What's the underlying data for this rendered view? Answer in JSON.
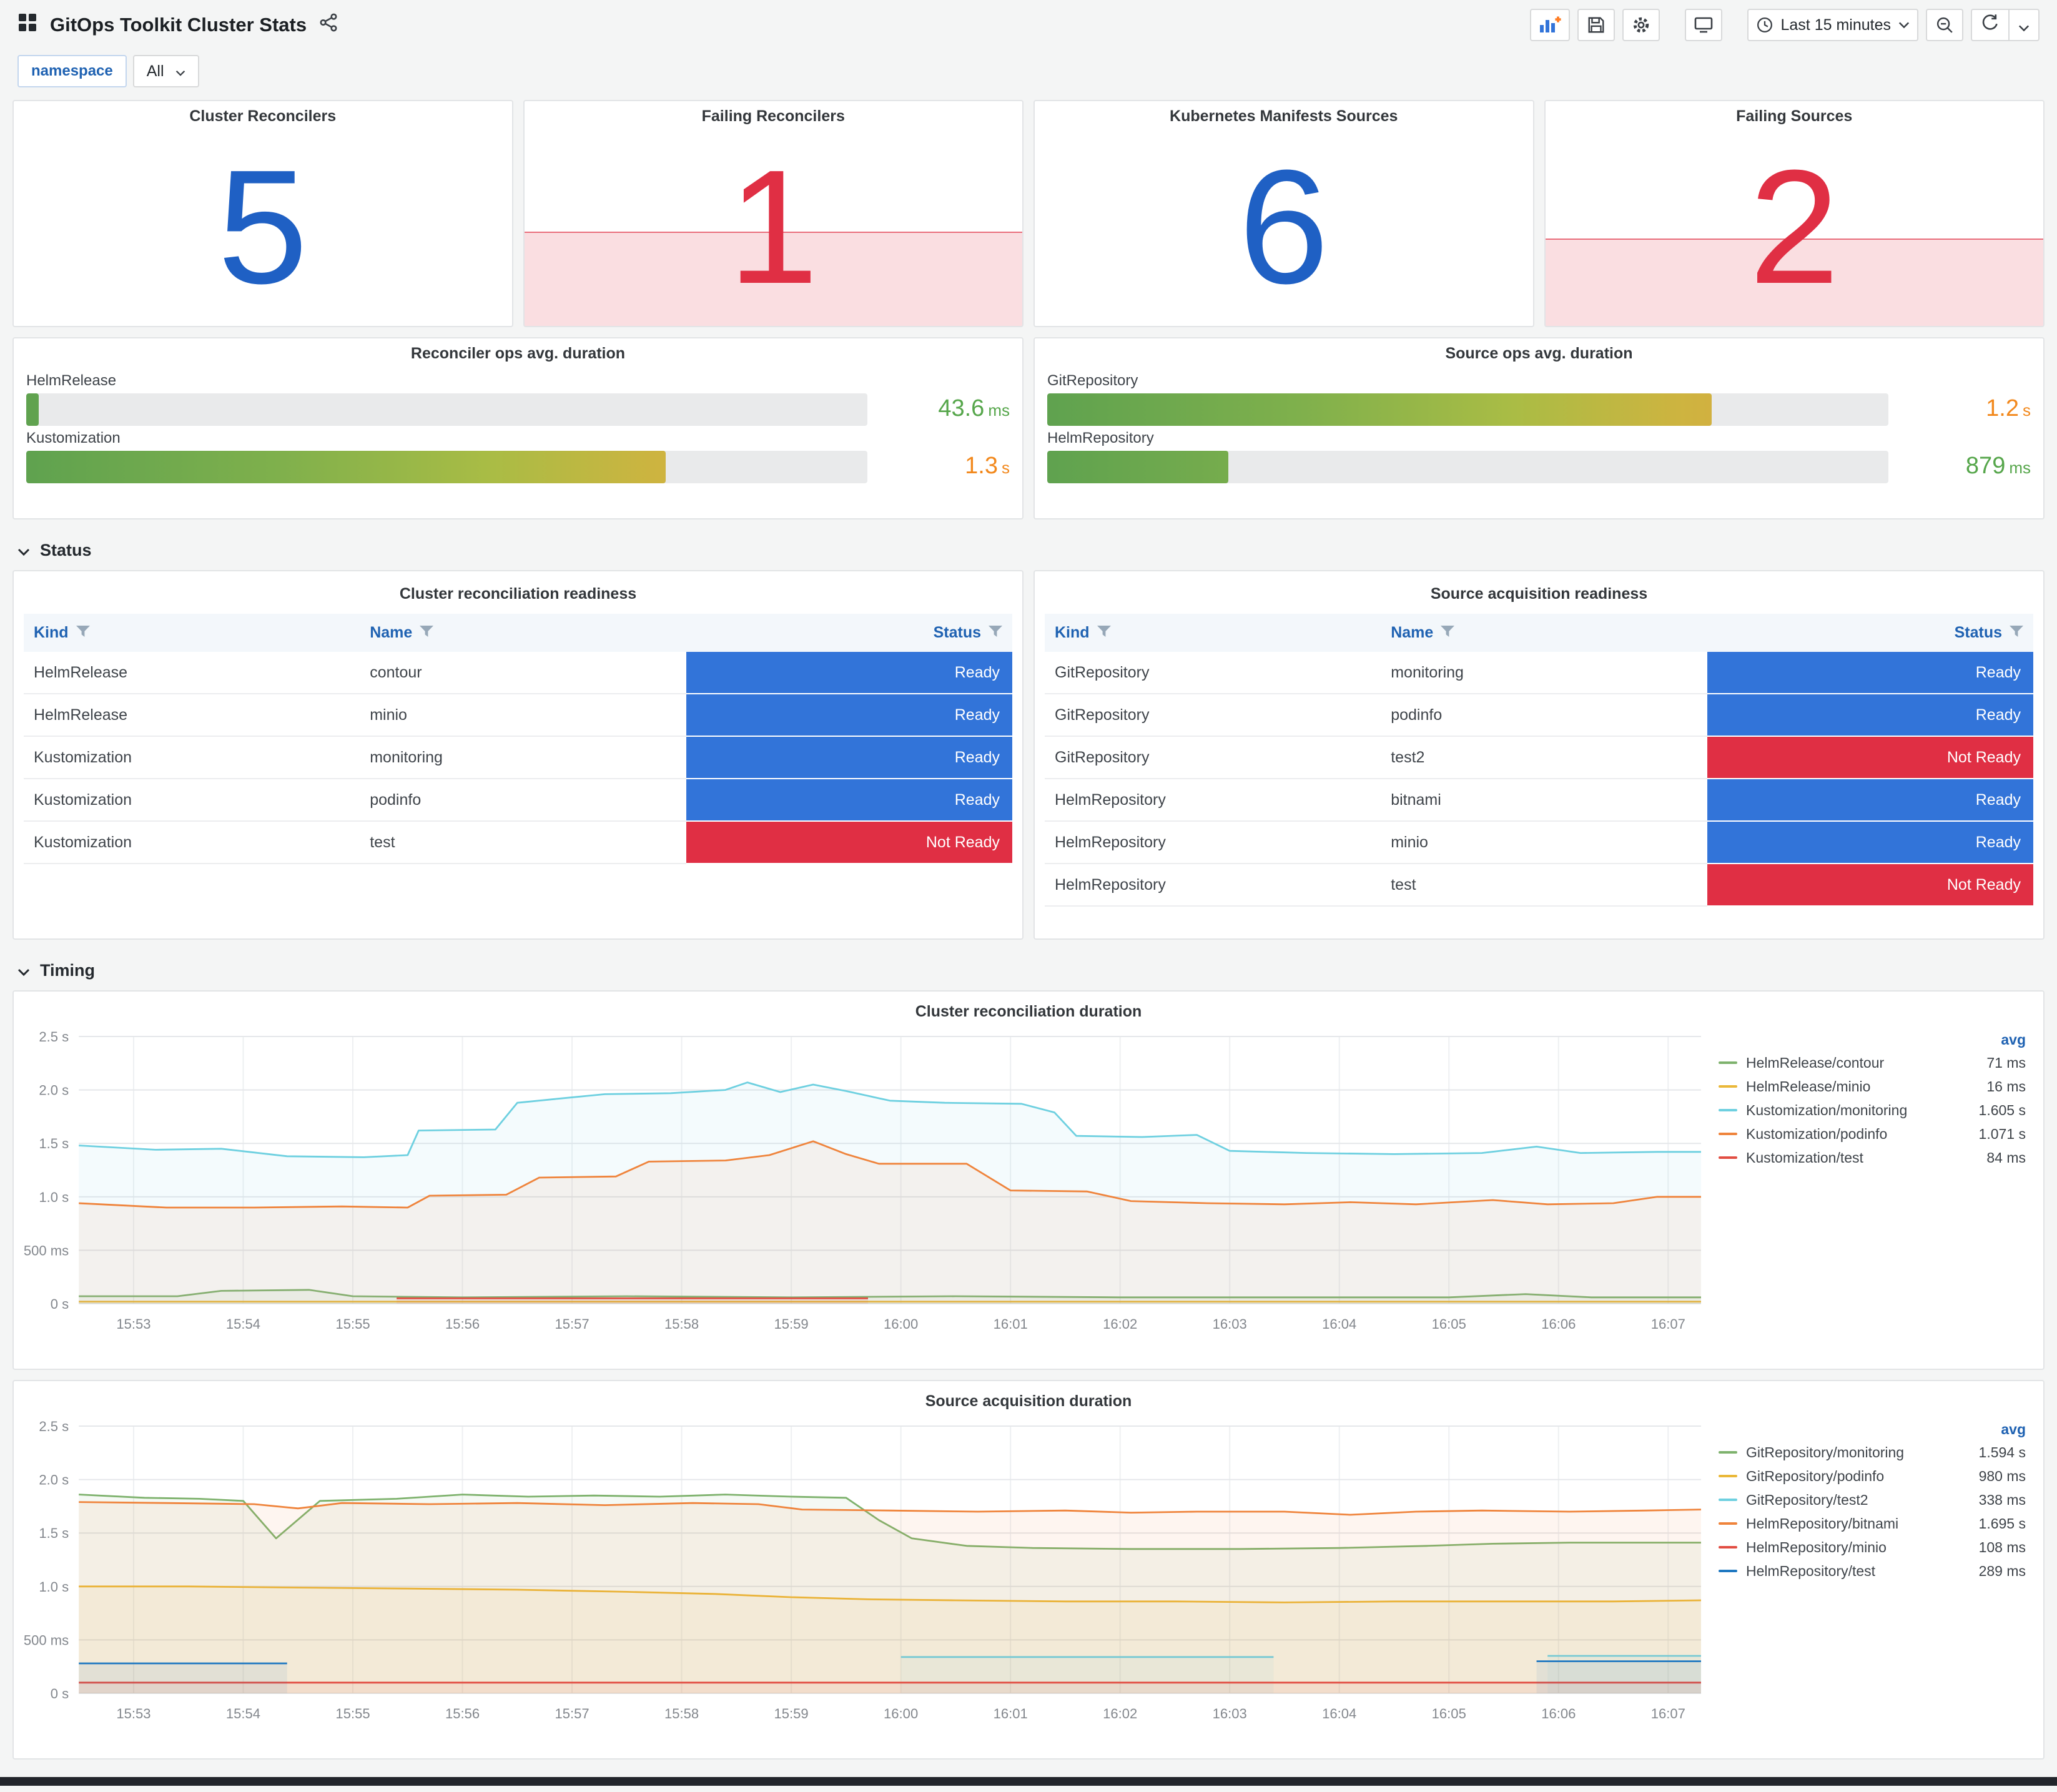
{
  "header": {
    "title": "GitOps Toolkit Cluster Stats",
    "time_range_label": "Last 15 minutes"
  },
  "variables": {
    "namespace_label": "namespace",
    "namespace_value": "All"
  },
  "stats": [
    {
      "title": "Cluster Reconcilers",
      "value": "5",
      "color": "#1F60C4"
    },
    {
      "title": "Failing Reconcilers",
      "value": "1",
      "color": "#E02F44",
      "area_pct": 42,
      "area_color": "rgba(224,47,68,0.16)",
      "area_line_color": "rgba(224,47,68,0.65)"
    },
    {
      "title": "Kubernetes Manifests Sources",
      "value": "6",
      "color": "#1F60C4"
    },
    {
      "title": "Failing Sources",
      "value": "2",
      "color": "#E02F44",
      "area_pct": 39,
      "area_color": "rgba(224,47,68,0.16)",
      "area_line_color": "rgba(224,47,68,0.65)"
    }
  ],
  "gauges": [
    {
      "title": "Reconciler ops avg. duration",
      "rows": [
        {
          "label": "HelmRelease",
          "percent": 1.5,
          "value": "43.6",
          "unit": "ms",
          "color": "#56A64B"
        },
        {
          "label": "Kustomization",
          "percent": 76,
          "value": "1.3",
          "unit": "s",
          "color": "#F2881C"
        }
      ]
    },
    {
      "title": "Source ops avg. duration",
      "rows": [
        {
          "label": "GitRepository",
          "percent": 79,
          "value": "1.2",
          "unit": "s",
          "color": "#F2881C"
        },
        {
          "label": "HelmRepository",
          "percent": 21.5,
          "value": "879",
          "unit": "ms",
          "color": "#56A64B"
        }
      ]
    }
  ],
  "sections": {
    "status": "Status",
    "timing": "Timing"
  },
  "status_colors": {
    "Ready": "#3274D9",
    "Not Ready": "#E02F44"
  },
  "tables": [
    {
      "title": "Cluster reconciliation readiness",
      "columns": [
        "Kind",
        "Name",
        "Status"
      ],
      "rows": [
        [
          "HelmRelease",
          "contour",
          "Ready"
        ],
        [
          "HelmRelease",
          "minio",
          "Ready"
        ],
        [
          "Kustomization",
          "monitoring",
          "Ready"
        ],
        [
          "Kustomization",
          "podinfo",
          "Ready"
        ],
        [
          "Kustomization",
          "test",
          "Not Ready"
        ]
      ]
    },
    {
      "title": "Source acquisition readiness",
      "columns": [
        "Kind",
        "Name",
        "Status"
      ],
      "rows": [
        [
          "GitRepository",
          "monitoring",
          "Ready"
        ],
        [
          "GitRepository",
          "podinfo",
          "Ready"
        ],
        [
          "GitRepository",
          "test2",
          "Not Ready"
        ],
        [
          "HelmRepository",
          "bitnami",
          "Ready"
        ],
        [
          "HelmRepository",
          "minio",
          "Ready"
        ],
        [
          "HelmRepository",
          "test",
          "Not Ready"
        ]
      ]
    }
  ],
  "chart_data": [
    {
      "type": "line",
      "title": "Cluster reconciliation duration",
      "legend_header": "avg",
      "ylim": [
        0,
        2.5
      ],
      "x_range": [
        0,
        14.8
      ],
      "yticks": [
        {
          "v": 0,
          "label": "0 s"
        },
        {
          "v": 0.5,
          "label": "500 ms"
        },
        {
          "v": 1,
          "label": "1.0 s"
        },
        {
          "v": 1.5,
          "label": "1.5 s"
        },
        {
          "v": 2,
          "label": "2.0 s"
        },
        {
          "v": 2.5,
          "label": "2.5 s"
        }
      ],
      "xticks": [
        {
          "v": 0.5,
          "label": "15:53"
        },
        {
          "v": 1.5,
          "label": "15:54"
        },
        {
          "v": 2.5,
          "label": "15:55"
        },
        {
          "v": 3.5,
          "label": "15:56"
        },
        {
          "v": 4.5,
          "label": "15:57"
        },
        {
          "v": 5.5,
          "label": "15:58"
        },
        {
          "v": 6.5,
          "label": "15:59"
        },
        {
          "v": 7.5,
          "label": "16:00"
        },
        {
          "v": 8.5,
          "label": "16:01"
        },
        {
          "v": 9.5,
          "label": "16:02"
        },
        {
          "v": 10.5,
          "label": "16:03"
        },
        {
          "v": 11.5,
          "label": "16:04"
        },
        {
          "v": 12.5,
          "label": "16:05"
        },
        {
          "v": 13.5,
          "label": "16:06"
        },
        {
          "v": 14.5,
          "label": "16:07"
        }
      ],
      "series": [
        {
          "name": "HelmRelease/contour",
          "color": "#7EB26D",
          "avg": "71 ms",
          "points": [
            [
              0,
              0.07
            ],
            [
              0.9,
              0.07
            ],
            [
              1.3,
              0.12
            ],
            [
              2.1,
              0.13
            ],
            [
              2.5,
              0.07
            ],
            [
              3.5,
              0.06
            ],
            [
              5,
              0.07
            ],
            [
              6.5,
              0.06
            ],
            [
              8,
              0.07
            ],
            [
              9.5,
              0.06
            ],
            [
              11,
              0.06
            ],
            [
              12.5,
              0.06
            ],
            [
              13.2,
              0.09
            ],
            [
              13.8,
              0.06
            ],
            [
              14.8,
              0.06
            ]
          ]
        },
        {
          "name": "HelmRelease/minio",
          "color": "#EAB839",
          "avg": "16 ms",
          "points": [
            [
              0,
              0.02
            ],
            [
              14.8,
              0.02
            ]
          ]
        },
        {
          "name": "Kustomization/monitoring",
          "color": "#6ED0E0",
          "avg": "1.605 s",
          "points": [
            [
              0,
              1.48
            ],
            [
              0.7,
              1.44
            ],
            [
              1.3,
              1.45
            ],
            [
              1.9,
              1.38
            ],
            [
              2.6,
              1.37
            ],
            [
              3.0,
              1.39
            ],
            [
              3.1,
              1.62
            ],
            [
              3.8,
              1.63
            ],
            [
              4.0,
              1.88
            ],
            [
              4.4,
              1.92
            ],
            [
              4.8,
              1.96
            ],
            [
              5.4,
              1.97
            ],
            [
              5.9,
              2.0
            ],
            [
              6.1,
              2.07
            ],
            [
              6.4,
              1.98
            ],
            [
              6.7,
              2.05
            ],
            [
              7.0,
              1.99
            ],
            [
              7.4,
              1.9
            ],
            [
              7.9,
              1.88
            ],
            [
              8.6,
              1.87
            ],
            [
              8.9,
              1.79
            ],
            [
              9.1,
              1.57
            ],
            [
              9.7,
              1.56
            ],
            [
              10.2,
              1.58
            ],
            [
              10.5,
              1.43
            ],
            [
              11.2,
              1.41
            ],
            [
              12.0,
              1.4
            ],
            [
              12.8,
              1.41
            ],
            [
              13.3,
              1.47
            ],
            [
              13.7,
              1.41
            ],
            [
              14.4,
              1.42
            ],
            [
              14.8,
              1.42
            ]
          ]
        },
        {
          "name": "Kustomization/podinfo",
          "color": "#EF843C",
          "avg": "1.071 s",
          "points": [
            [
              0,
              0.94
            ],
            [
              0.8,
              0.9
            ],
            [
              1.6,
              0.9
            ],
            [
              2.4,
              0.91
            ],
            [
              3.0,
              0.9
            ],
            [
              3.2,
              1.01
            ],
            [
              3.9,
              1.02
            ],
            [
              4.2,
              1.18
            ],
            [
              4.9,
              1.19
            ],
            [
              5.2,
              1.33
            ],
            [
              5.9,
              1.34
            ],
            [
              6.3,
              1.39
            ],
            [
              6.7,
              1.52
            ],
            [
              7.0,
              1.4
            ],
            [
              7.3,
              1.31
            ],
            [
              8.1,
              1.31
            ],
            [
              8.5,
              1.06
            ],
            [
              9.2,
              1.05
            ],
            [
              9.6,
              0.96
            ],
            [
              10.3,
              0.94
            ],
            [
              11.0,
              0.93
            ],
            [
              11.6,
              0.95
            ],
            [
              12.2,
              0.93
            ],
            [
              12.9,
              0.97
            ],
            [
              13.4,
              0.93
            ],
            [
              14.0,
              0.94
            ],
            [
              14.4,
              1.0
            ],
            [
              14.8,
              1.0
            ]
          ]
        },
        {
          "name": "Kustomization/test",
          "color": "#E24D42",
          "avg": "84 ms",
          "points": [
            [
              2.9,
              0.05
            ],
            [
              7.2,
              0.05
            ]
          ]
        }
      ]
    },
    {
      "type": "line",
      "title": "Source acquisition duration",
      "legend_header": "avg",
      "ylim": [
        0,
        2.5
      ],
      "x_range": [
        0,
        14.8
      ],
      "yticks": [
        {
          "v": 0,
          "label": "0 s"
        },
        {
          "v": 0.5,
          "label": "500 ms"
        },
        {
          "v": 1,
          "label": "1.0 s"
        },
        {
          "v": 1.5,
          "label": "1.5 s"
        },
        {
          "v": 2,
          "label": "2.0 s"
        },
        {
          "v": 2.5,
          "label": "2.5 s"
        }
      ],
      "xticks": [
        {
          "v": 0.5,
          "label": "15:53"
        },
        {
          "v": 1.5,
          "label": "15:54"
        },
        {
          "v": 2.5,
          "label": "15:55"
        },
        {
          "v": 3.5,
          "label": "15:56"
        },
        {
          "v": 4.5,
          "label": "15:57"
        },
        {
          "v": 5.5,
          "label": "15:58"
        },
        {
          "v": 6.5,
          "label": "15:59"
        },
        {
          "v": 7.5,
          "label": "16:00"
        },
        {
          "v": 8.5,
          "label": "16:01"
        },
        {
          "v": 9.5,
          "label": "16:02"
        },
        {
          "v": 10.5,
          "label": "16:03"
        },
        {
          "v": 11.5,
          "label": "16:04"
        },
        {
          "v": 12.5,
          "label": "16:05"
        },
        {
          "v": 13.5,
          "label": "16:06"
        },
        {
          "v": 14.5,
          "label": "16:07"
        }
      ],
      "series": [
        {
          "name": "GitRepository/monitoring",
          "color": "#7EB26D",
          "avg": "1.594 s",
          "points": [
            [
              0,
              1.86
            ],
            [
              0.6,
              1.83
            ],
            [
              1.1,
              1.82
            ],
            [
              1.5,
              1.8
            ],
            [
              1.8,
              1.45
            ],
            [
              2.2,
              1.8
            ],
            [
              2.9,
              1.82
            ],
            [
              3.5,
              1.86
            ],
            [
              4.1,
              1.84
            ],
            [
              4.7,
              1.85
            ],
            [
              5.3,
              1.84
            ],
            [
              5.9,
              1.86
            ],
            [
              6.5,
              1.84
            ],
            [
              7.0,
              1.83
            ],
            [
              7.3,
              1.62
            ],
            [
              7.6,
              1.45
            ],
            [
              8.1,
              1.38
            ],
            [
              8.7,
              1.36
            ],
            [
              9.6,
              1.35
            ],
            [
              10.6,
              1.35
            ],
            [
              11.5,
              1.36
            ],
            [
              12.3,
              1.38
            ],
            [
              12.9,
              1.4
            ],
            [
              13.6,
              1.41
            ],
            [
              14.8,
              1.41
            ]
          ]
        },
        {
          "name": "GitRepository/podinfo",
          "color": "#EAB839",
          "avg": "980 ms",
          "points": [
            [
              0,
              1.0
            ],
            [
              1,
              1.0
            ],
            [
              2,
              0.99
            ],
            [
              3,
              0.98
            ],
            [
              4,
              0.97
            ],
            [
              5,
              0.95
            ],
            [
              5.8,
              0.93
            ],
            [
              6.5,
              0.9
            ],
            [
              7.2,
              0.88
            ],
            [
              8,
              0.87
            ],
            [
              9,
              0.86
            ],
            [
              10,
              0.86
            ],
            [
              11,
              0.85
            ],
            [
              12,
              0.86
            ],
            [
              13,
              0.86
            ],
            [
              14,
              0.86
            ],
            [
              14.8,
              0.87
            ]
          ]
        },
        {
          "name": "GitRepository/test2",
          "color": "#6ED0E0",
          "avg": "338 ms",
          "points": [
            [
              7.5,
              0.34
            ],
            [
              10.9,
              0.34
            ],
            null,
            [
              13.4,
              0.35
            ],
            [
              14.8,
              0.35
            ]
          ]
        },
        {
          "name": "HelmRepository/bitnami",
          "color": "#EF843C",
          "avg": "1.695 s",
          "points": [
            [
              0,
              1.79
            ],
            [
              0.8,
              1.78
            ],
            [
              1.6,
              1.77
            ],
            [
              2.0,
              1.73
            ],
            [
              2.4,
              1.78
            ],
            [
              3.2,
              1.77
            ],
            [
              4.0,
              1.78
            ],
            [
              4.8,
              1.76
            ],
            [
              5.6,
              1.78
            ],
            [
              6.2,
              1.77
            ],
            [
              6.6,
              1.72
            ],
            [
              7.4,
              1.71
            ],
            [
              8.2,
              1.7
            ],
            [
              9.0,
              1.71
            ],
            [
              9.6,
              1.69
            ],
            [
              10.2,
              1.7
            ],
            [
              11.0,
              1.7
            ],
            [
              11.6,
              1.67
            ],
            [
              12.2,
              1.7
            ],
            [
              12.8,
              1.71
            ],
            [
              13.6,
              1.7
            ],
            [
              14.3,
              1.71
            ],
            [
              14.8,
              1.72
            ]
          ]
        },
        {
          "name": "HelmRepository/minio",
          "color": "#E24D42",
          "avg": "108 ms",
          "points": [
            [
              0,
              0.1
            ],
            [
              14.8,
              0.1
            ]
          ]
        },
        {
          "name": "HelmRepository/test",
          "color": "#1F78C1",
          "avg": "289 ms",
          "points": [
            [
              0,
              0.28
            ],
            [
              1.9,
              0.28
            ],
            null,
            [
              13.3,
              0.3
            ],
            [
              14.8,
              0.3
            ]
          ]
        }
      ]
    }
  ]
}
